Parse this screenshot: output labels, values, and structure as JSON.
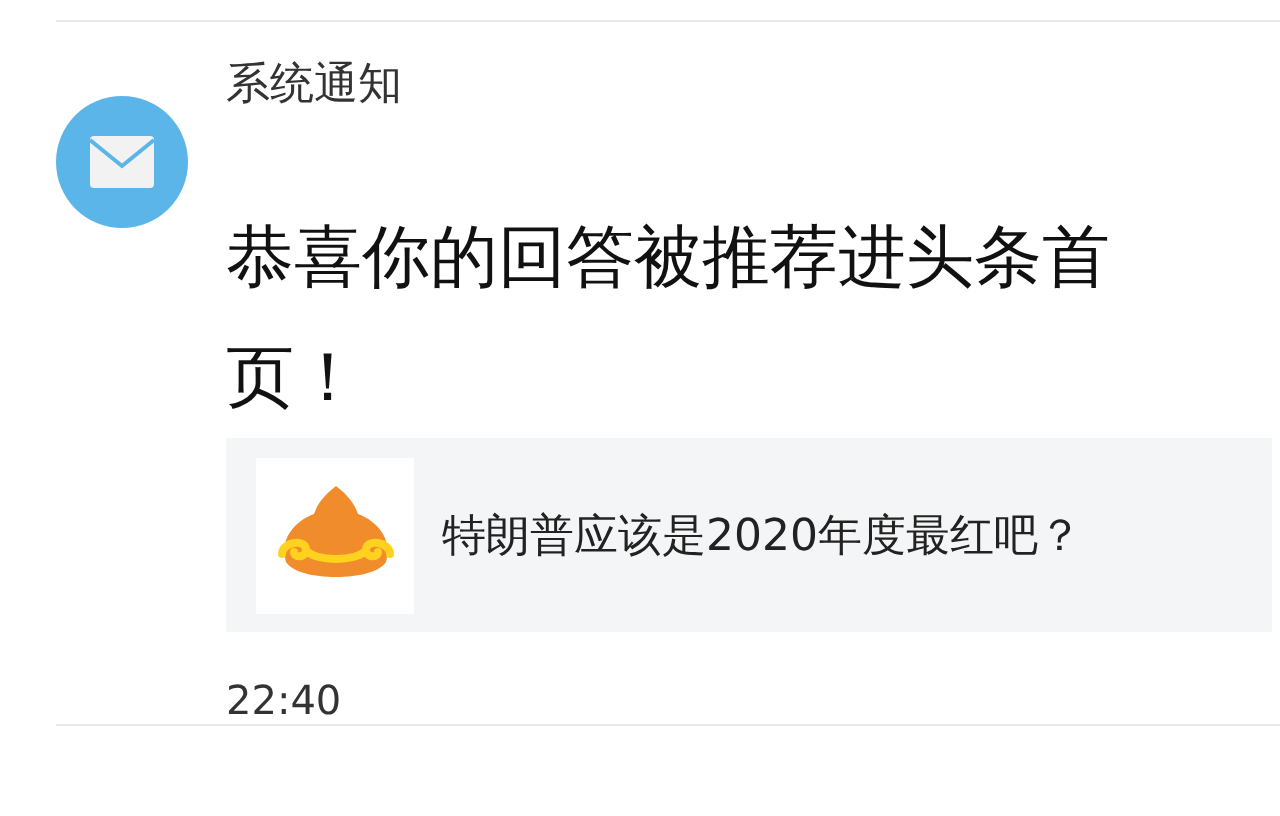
{
  "notification": {
    "sender": "系统通知",
    "message": "恭喜你的回答被推荐进头条首页！",
    "card": {
      "question": "特朗普应该是2020年度最红吧？"
    },
    "time": "22:40"
  }
}
